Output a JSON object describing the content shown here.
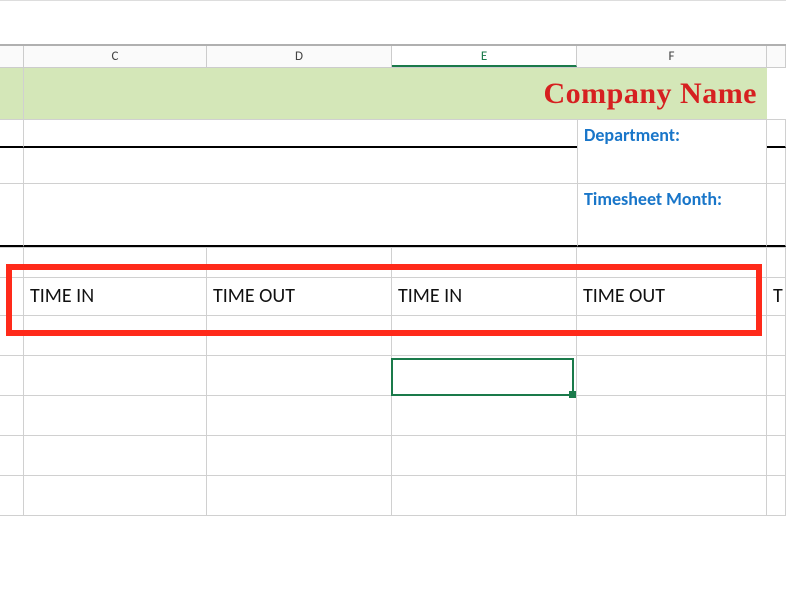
{
  "columns": {
    "c": "C",
    "d": "D",
    "e": "E",
    "f": "F"
  },
  "title": "Company Name",
  "labels": {
    "department": "Department:",
    "timesheet_month": "Timesheet Month:"
  },
  "table_headers": {
    "c": "TIME IN",
    "d": "TIME OUT",
    "e": "TIME IN",
    "f": "TIME OUT",
    "g": "T"
  },
  "chart_data": {
    "type": "table",
    "title": "Company Name",
    "columns": [
      "TIME IN",
      "TIME OUT",
      "TIME IN",
      "TIME OUT"
    ],
    "rows": []
  }
}
